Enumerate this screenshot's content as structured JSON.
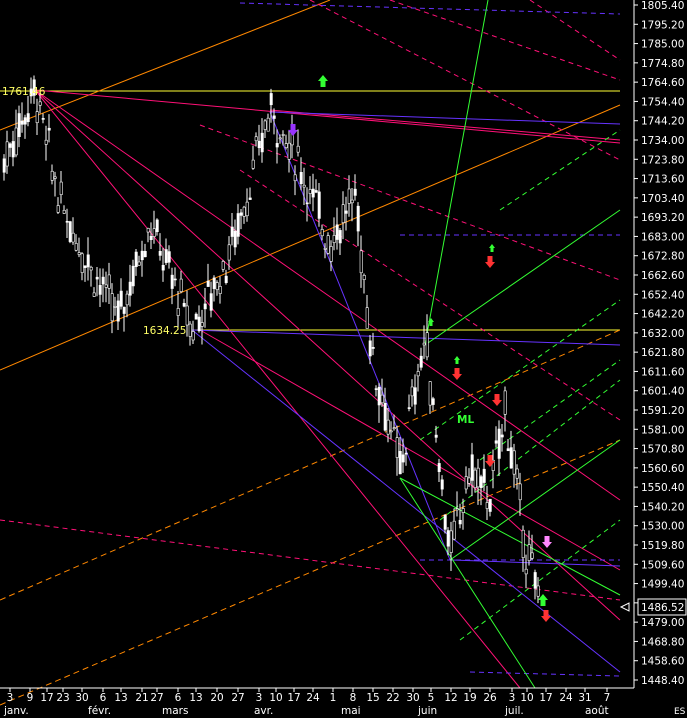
{
  "chart_data": {
    "type": "candlestick",
    "symbol": "ES",
    "last_price": "1486.52",
    "ylim": [
      1444,
      1808
    ],
    "y_ticks": [
      "1805.40",
      "1795.20",
      "1785.00",
      "1774.80",
      "1764.60",
      "1754.40",
      "1744.20",
      "1734.00",
      "1723.80",
      "1713.60",
      "1703.40",
      "1693.20",
      "1683.00",
      "1672.80",
      "1662.60",
      "1652.40",
      "1642.20",
      "1632.00",
      "1621.80",
      "1611.60",
      "1601.40",
      "1591.20",
      "1581.00",
      "1570.80",
      "1560.60",
      "1550.40",
      "1540.20",
      "1530.00",
      "1519.80",
      "1509.60",
      "1499.40",
      "1489.20",
      "1479.00",
      "1468.80",
      "1458.60",
      "1448.40"
    ],
    "x_day_ticks": [
      "3",
      "9",
      "17",
      "23",
      "30",
      "6",
      "13",
      "21",
      "27",
      "6",
      "13",
      "20",
      "27",
      "3",
      "10",
      "17",
      "24",
      "1",
      "8",
      "15",
      "22",
      "30",
      "5",
      "12",
      "19",
      "26",
      "3",
      "10",
      "17",
      "24",
      "31",
      "7"
    ],
    "x_month_ticks": [
      "janv.",
      "févr.",
      "mars",
      "avr.",
      "mai",
      "juin",
      "juil.",
      "août"
    ],
    "level_labels": [
      "1761.46",
      "1634.25"
    ],
    "annotations": [
      "ML"
    ],
    "key_points": [
      {
        "date": "2008-01-03",
        "price": 1722
      },
      {
        "date": "2008-01-15",
        "price": 1761.46
      },
      {
        "date": "2008-03-11",
        "price": 1634.25
      },
      {
        "date": "2008-04-10",
        "price": 1751
      },
      {
        "date": "2008-05-06",
        "price": 1680
      },
      {
        "date": "2008-05-23",
        "price": 1560
      },
      {
        "date": "2008-06-06",
        "price": 1630
      },
      {
        "date": "2008-06-20",
        "price": 1514
      },
      {
        "date": "2008-07-08",
        "price": 1592
      },
      {
        "date": "2008-07-17",
        "price": 1486.52
      }
    ],
    "colors": {
      "background": "#000000",
      "candles": "#ffffff",
      "axis_text": "#ffffff",
      "level_label": "#ffff66",
      "highlight": "#ffff00"
    }
  }
}
